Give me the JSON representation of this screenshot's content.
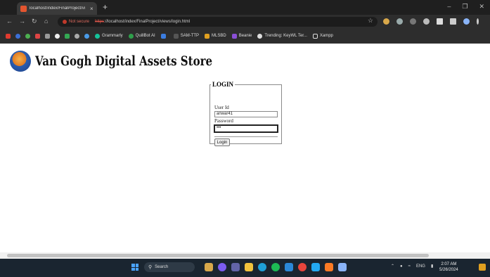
{
  "browser": {
    "tab_title": "localhost/index/FinalProject/vi",
    "tab_close": "×",
    "new_tab": "+",
    "security_label": "Not secure",
    "url_scheme": "https",
    "url_rest": "://localhost/index/FinalProject/views/login.html",
    "bookmarks": [
      "Grammarly",
      "QuillBot AI",
      "SAM-TTP",
      "MLSBD",
      "Beanie",
      "Trending: KeyWL Ter...",
      "Xampp"
    ]
  },
  "site": {
    "title": "Van Gogh Digital Assets Store"
  },
  "login": {
    "legend": "LOGIN",
    "user_label": "User Id",
    "user_value": "anwar41",
    "password_label": "Password",
    "password_value": "•••",
    "button_label": "Login"
  },
  "taskbar": {
    "search_label": "Search",
    "time": "2:07 AM",
    "date": "5/26/2024",
    "lang": "ENG"
  },
  "colors": {
    "taskbar_bg": "#1a2530",
    "chrome_bg": "#2d2d2d",
    "not_secure": "#e06b5f"
  }
}
